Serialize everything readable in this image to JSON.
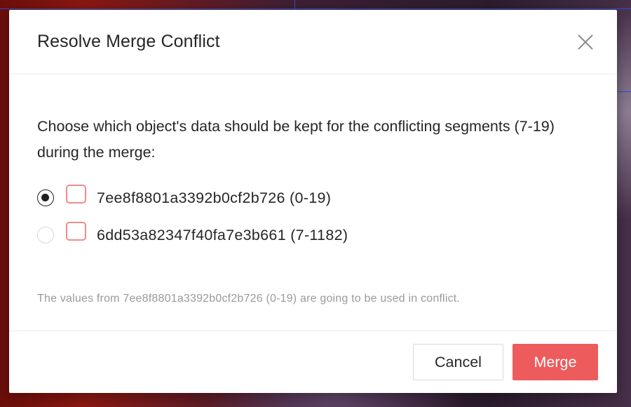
{
  "dialog": {
    "title": "Resolve Merge Conflict",
    "close_icon": "close-icon",
    "description": "Choose which object's data should be kept for the conflicting segments (7-19) during the merge:",
    "options": [
      {
        "label": "7ee8f8801a3392b0cf2b726 (0-19)",
        "selected": true,
        "color": "#f28b8b"
      },
      {
        "label": "6dd53a82347f40fa7e3b661 (7-1182)",
        "selected": false,
        "color": "#f28b8b"
      }
    ],
    "note": "The values from 7ee8f8801a3392b0cf2b726 (0-19) are going to be used in conflict.",
    "cancel_label": "Cancel",
    "merge_label": "Merge"
  },
  "colors": {
    "primary": "#ee5b5c",
    "object_outline": "#f28b8b",
    "text": "#262626",
    "muted_text": "#9a9a9a"
  }
}
